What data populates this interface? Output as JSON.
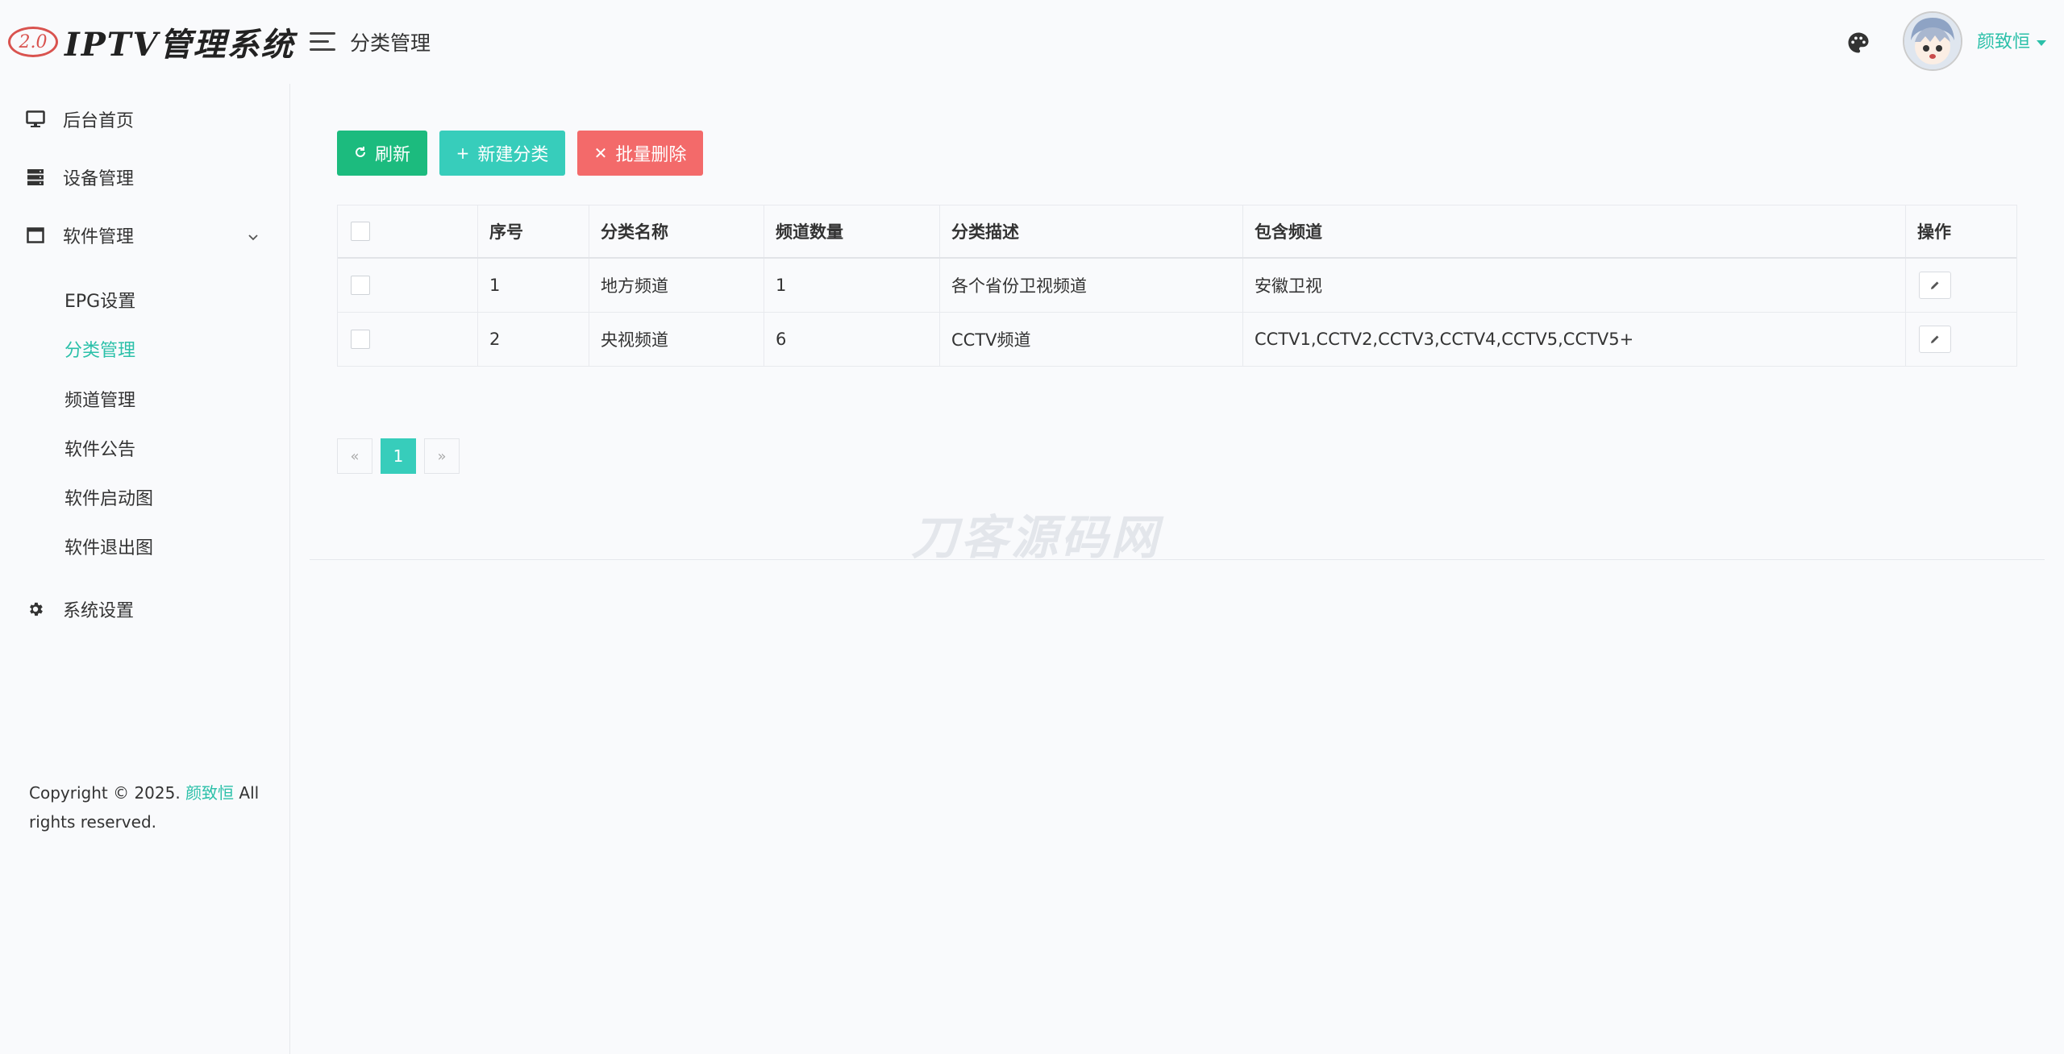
{
  "header": {
    "logo_badge": "2.0",
    "logo_text": "IPTV管理系统",
    "breadcrumb": "分类管理",
    "user_name": "颜致恒"
  },
  "sidebar": {
    "items": [
      {
        "label": "后台首页",
        "icon": "monitor-icon"
      },
      {
        "label": "设备管理",
        "icon": "server-icon"
      },
      {
        "label": "软件管理",
        "icon": "window-icon"
      },
      {
        "label": "系统设置",
        "icon": "gear-icon"
      }
    ],
    "sub_items": [
      {
        "label": "EPG设置"
      },
      {
        "label": "分类管理",
        "active": true
      },
      {
        "label": "频道管理"
      },
      {
        "label": "软件公告"
      },
      {
        "label": "软件启动图"
      },
      {
        "label": "软件退出图"
      }
    ],
    "copyright_prefix": "Copyright © 2025.",
    "copyright_owner": "颜致恒",
    "copyright_suffix": "All rights reserved."
  },
  "toolbar": {
    "refresh_label": "刷新",
    "new_label": "新建分类",
    "delete_label": "批量删除"
  },
  "table": {
    "columns": [
      "序号",
      "分类名称",
      "频道数量",
      "分类描述",
      "包含频道",
      "操作"
    ],
    "rows": [
      {
        "id": "1",
        "name": "地方频道",
        "count": "1",
        "desc": "各个省份卫视频道",
        "channels": "安徽卫视"
      },
      {
        "id": "2",
        "name": "央视频道",
        "count": "6",
        "desc": "CCTV频道",
        "channels": "CCTV1,CCTV2,CCTV3,CCTV4,CCTV5,CCTV5+"
      }
    ]
  },
  "pagination": {
    "prev": "«",
    "current": "1",
    "next": "»"
  },
  "watermark": "刀客源码网",
  "colors": {
    "accent": "#2bc0a9",
    "refresh": "#1cbb7e",
    "new": "#37cdbb",
    "delete": "#f36a6a"
  }
}
